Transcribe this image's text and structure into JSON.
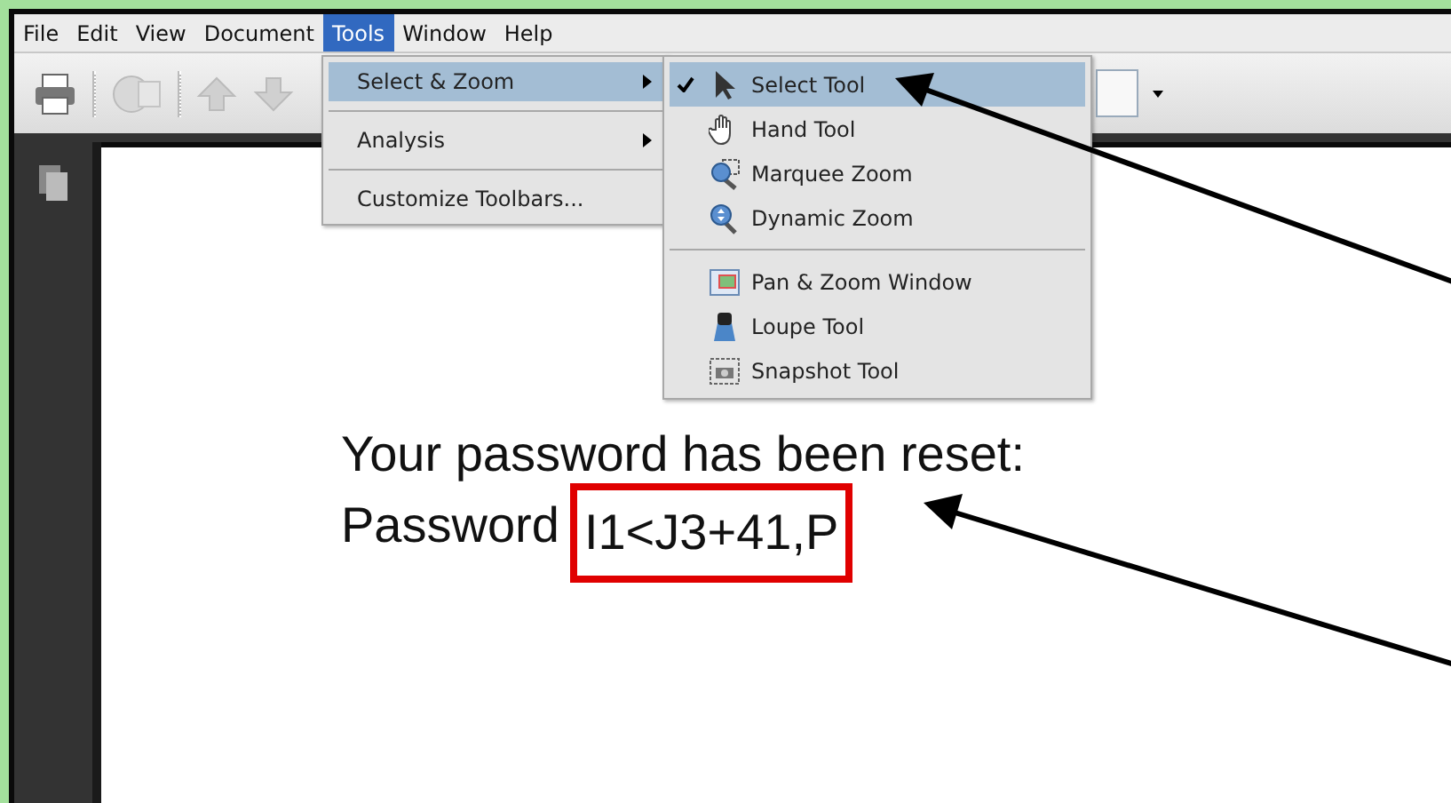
{
  "menu_bar": [
    {
      "label": "File",
      "selected": false
    },
    {
      "label": "Edit",
      "selected": false
    },
    {
      "label": "View",
      "selected": false
    },
    {
      "label": "Document",
      "selected": false
    },
    {
      "label": "Tools",
      "selected": true
    },
    {
      "label": "Window",
      "selected": false
    },
    {
      "label": "Help",
      "selected": false
    }
  ],
  "tools_menu": {
    "groups": [
      [
        {
          "label": "Select & Zoom",
          "has_submenu": true,
          "selected": true
        }
      ],
      [
        {
          "label": "Analysis",
          "has_submenu": true,
          "selected": false
        }
      ],
      [
        {
          "label": "Customize Toolbars...",
          "has_submenu": false,
          "selected": false
        }
      ]
    ]
  },
  "submenu": {
    "groups": [
      [
        {
          "label": "Select Tool",
          "kind": "arrow",
          "checked": true,
          "selected": true
        },
        {
          "label": "Hand Tool",
          "kind": "hand",
          "checked": false,
          "selected": false
        },
        {
          "label": "Marquee Zoom",
          "kind": "marquee",
          "checked": false,
          "selected": false
        },
        {
          "label": "Dynamic Zoom",
          "kind": "dynamic",
          "checked": false,
          "selected": false
        }
      ],
      [
        {
          "label": "Pan & Zoom Window",
          "kind": "panzoom",
          "checked": false,
          "selected": false
        },
        {
          "label": "Loupe Tool",
          "kind": "loupe",
          "checked": false,
          "selected": false
        },
        {
          "label": "Snapshot Tool",
          "kind": "snapshot",
          "checked": false,
          "selected": false
        }
      ]
    ]
  },
  "document": {
    "heading": "Your password has been reset:",
    "password_label": "Password",
    "password_value": "I1<J3+41,P",
    "password_highlighted": true
  }
}
